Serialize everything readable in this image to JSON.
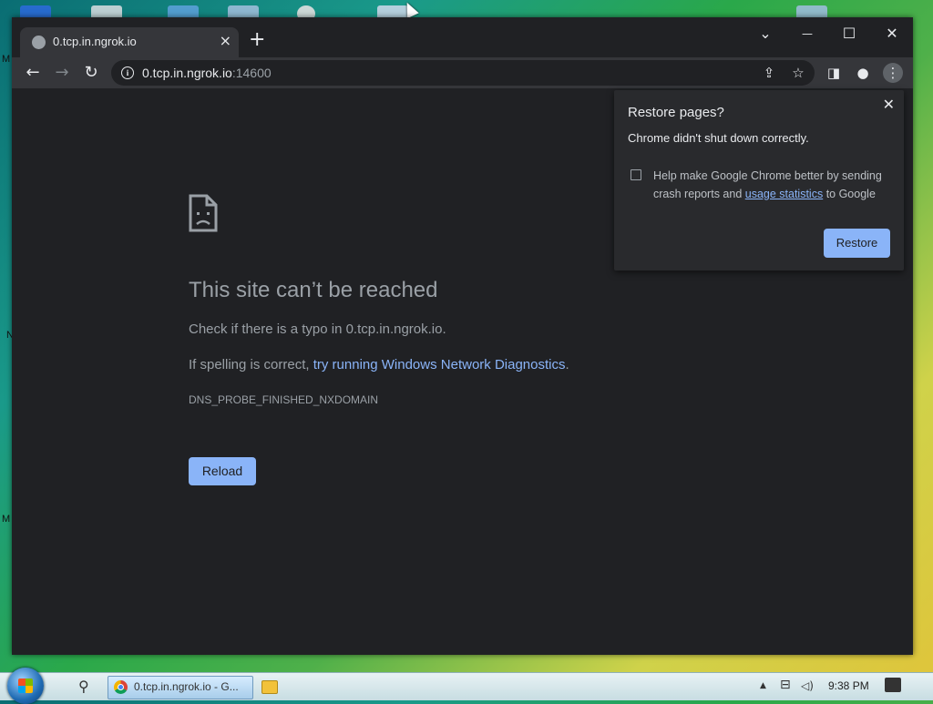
{
  "desktop": {
    "edge_letters": [
      "M",
      "N",
      "M"
    ]
  },
  "browser": {
    "tab": {
      "title": "0.tcp.in.ngrok.io",
      "close_glyph": "×"
    },
    "new_tab_glyph": "+",
    "window_controls": {
      "dropdown": "⌄",
      "minimize": "—",
      "maximize": "☐",
      "close": "✕"
    },
    "toolbar": {
      "back": "←",
      "forward": "→",
      "reload": "↻",
      "url_host": "0.tcp.in.ngrok.io",
      "url_port": ":14600",
      "share": "⇪",
      "bookmark": "☆",
      "side_panel": "◨",
      "profile": "●",
      "menu": "⋮"
    }
  },
  "error_page": {
    "title": "This site can’t be reached",
    "line1": "Check if there is a typo in 0.tcp.in.ngrok.io.",
    "line2_prefix": "If spelling is correct, ",
    "line2_link": "try running Windows Network Diagnostics",
    "line2_suffix": ".",
    "error_code": "DNS_PROBE_FINISHED_NXDOMAIN",
    "reload_label": "Reload"
  },
  "restore_popup": {
    "title": "Restore pages?",
    "message": "Chrome didn't shut down correctly.",
    "checkbox_text_prefix": "Help make Google Chrome better by sending crash reports and ",
    "checkbox_link": "usage statistics",
    "checkbox_text_suffix": " to Google",
    "checkbox_checked": false,
    "restore_label": "Restore",
    "close_glyph": "✕"
  },
  "taskbar": {
    "search_glyph": "⚲",
    "chrome_task_label": "0.tcp.in.ngrok.io - G...",
    "tray_up": "▲",
    "tray_network": "⊟",
    "tray_volume": "◁)",
    "clock": "9:38 PM"
  },
  "colors": {
    "accent": "#8ab4f8",
    "page_bg": "#202124",
    "toolbar_bg": "#35363a",
    "popup_bg": "#292a2d"
  }
}
